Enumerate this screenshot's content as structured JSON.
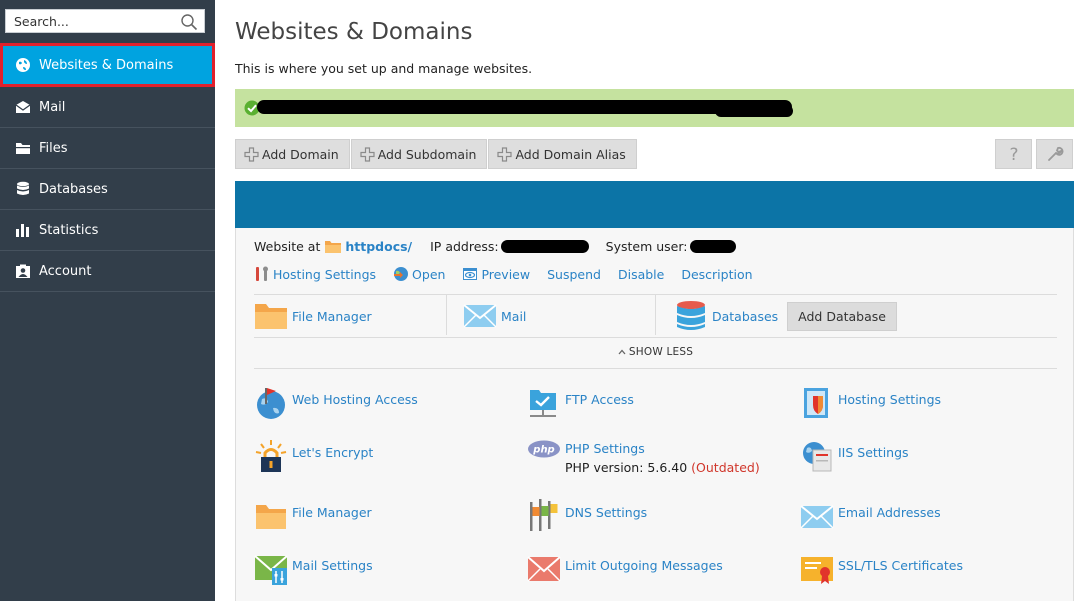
{
  "sidebar": {
    "search_placeholder": "Search...",
    "items": [
      {
        "label": "Websites & Domains",
        "icon": "globe-icon",
        "active": true
      },
      {
        "label": "Mail",
        "icon": "envelope-icon"
      },
      {
        "label": "Files",
        "icon": "folder-icon"
      },
      {
        "label": "Databases",
        "icon": "database-icon"
      },
      {
        "label": "Statistics",
        "icon": "bar-chart-icon"
      },
      {
        "label": "Account",
        "icon": "account-icon"
      }
    ]
  },
  "page": {
    "title": "Websites & Domains",
    "description": "This is where you set up and manage websites."
  },
  "toolbar": {
    "add_domain": "Add Domain",
    "add_subdomain": "Add Subdomain",
    "add_domain_alias": "Add Domain Alias",
    "help_icon": "help-icon",
    "settings_icon": "wrench-icon"
  },
  "site": {
    "website_at_label": "Website at",
    "docroot": "httpdocs/",
    "ip_label": "IP address:",
    "system_user_label": "System user:"
  },
  "actions": {
    "hosting_settings": "Hosting Settings",
    "open": "Open",
    "preview": "Preview",
    "suspend": "Suspend",
    "disable": "Disable",
    "description": "Description"
  },
  "quick": {
    "file_manager": "File Manager",
    "mail": "Mail",
    "databases": "Databases",
    "add_database": "Add Database"
  },
  "show_less": "SHOW LESS",
  "tools": {
    "web_hosting_access": "Web Hosting Access",
    "ftp_access": "FTP Access",
    "hosting_settings": "Hosting Settings",
    "lets_encrypt": "Let's Encrypt",
    "php_settings": "PHP Settings",
    "php_version_label": "PHP version: 5.6.40",
    "php_outdated": "(Outdated)",
    "iis_settings": "IIS Settings",
    "file_manager": "File Manager",
    "dns_settings": "DNS Settings",
    "email_addresses": "Email Addresses",
    "mail_settings": "Mail Settings",
    "limit_outgoing": "Limit Outgoing Messages",
    "ssl_tls": "SSL/TLS Certificates"
  },
  "colors": {
    "sidebar_bg": "#323e4a",
    "active_item": "#00a3e0",
    "active_outline": "#e1202b",
    "success_bg": "#c5e29f",
    "header_band": "#0c74a6",
    "link": "#2a83c6",
    "outdated": "#d0362b"
  }
}
